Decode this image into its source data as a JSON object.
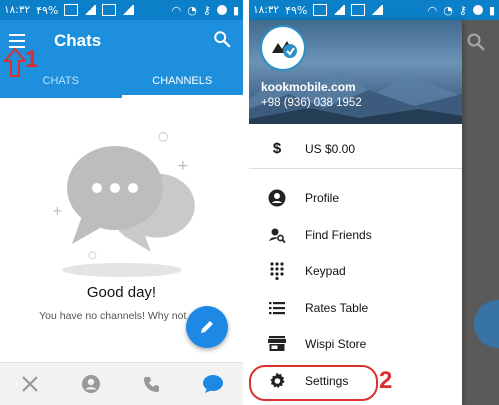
{
  "left_screen": {
    "status_bar": {
      "time": "۱۸:۳۲",
      "battery": "۴۹%"
    },
    "app_bar": {
      "title": "Chats"
    },
    "tabs": [
      {
        "label": "CHATS",
        "active": false
      },
      {
        "label": "CHANNELS",
        "active": true
      }
    ],
    "annotation": {
      "number": "1",
      "color": "#d93030"
    },
    "empty_state": {
      "greeting": "Good day!",
      "message": "You have no channels! Why not cre"
    },
    "bottom_nav": [
      "tools-icon",
      "contacts-icon",
      "phone-icon",
      "chat-icon"
    ],
    "accent_color": "#1e8fdc"
  },
  "right_screen": {
    "status_bar": {
      "time": "۱۸:۳۲",
      "battery": "۴۹%"
    },
    "drawer_header": {
      "name": "kookmobile.com",
      "phone": "+98 (936)  038 1952"
    },
    "balance": {
      "symbol": "$",
      "label": "US $0.00"
    },
    "menu_items": [
      {
        "label": "Profile",
        "icon": "account-circle-icon"
      },
      {
        "label": "Find Friends",
        "icon": "person-search-icon"
      },
      {
        "label": "Keypad",
        "icon": "dialpad-icon"
      },
      {
        "label": "Rates Table",
        "icon": "list-icon"
      },
      {
        "label": "Wispi Store",
        "icon": "store-icon"
      },
      {
        "label": "Settings",
        "icon": "gear-icon"
      }
    ],
    "annotation": {
      "number": "2",
      "color": "#d93030"
    }
  }
}
